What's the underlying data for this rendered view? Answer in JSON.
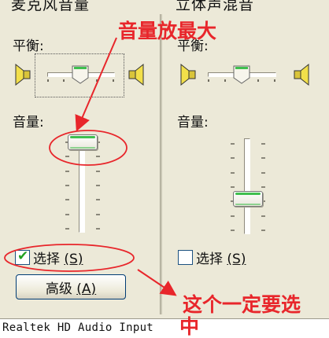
{
  "mixer": {
    "mic_column": {
      "title": "麦克风音量",
      "balance_label": "平衡:",
      "volume_label": "音量:",
      "select_label": "选择",
      "select_key": "(S)",
      "select_checked": true,
      "advanced_label": "高级",
      "advanced_key": "(A)",
      "volume_level": 0.95,
      "balance_level": 0.5
    },
    "stereo_column": {
      "title": "立体声混音",
      "balance_label": "平衡:",
      "volume_label": "音量:",
      "select_label": "选择",
      "select_key": "(S)",
      "select_checked": false,
      "volume_level": 0.25,
      "balance_level": 0.5
    },
    "device_name": "Realtek HD Audio Input"
  },
  "annotations": {
    "volume_max_note": "音量放最大",
    "must_select_note_line1": "这个一定要选",
    "must_select_note_line2": "中"
  },
  "colors": {
    "annotation_red": "#e8262b",
    "window_background": "#ece9d8",
    "slider_accent": "#3fbf4f"
  }
}
